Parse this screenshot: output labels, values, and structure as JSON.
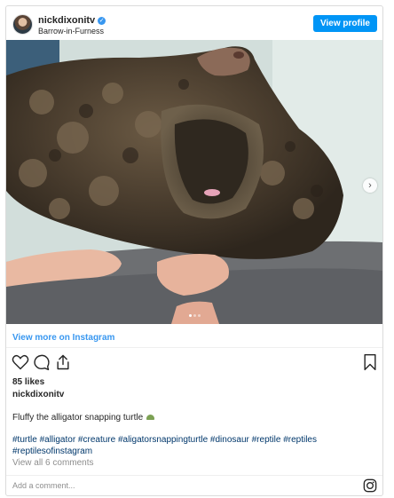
{
  "header": {
    "username": "nickdixonitv",
    "verified_icon": "verified-badge-icon",
    "location": "Barrow-in-Furness",
    "view_profile_label": "View profile"
  },
  "media": {
    "alt": "Fluffy the alligator snapping turtle",
    "carousel_dots": 3,
    "active_dot": 1,
    "next_icon": "chevron-right-icon"
  },
  "links": {
    "view_more": "View more on Instagram"
  },
  "actions": {
    "icons": [
      "heart-icon",
      "comment-icon",
      "share-icon",
      "bookmark-icon"
    ]
  },
  "post": {
    "likes": "85 likes",
    "author": "nickdixonitv",
    "caption": "Fluffy the alligator snapping turtle",
    "caption_emoji": "turtle-emoji",
    "hashtags": "#turtle #alligator #creature #aligatorsnappingturtle #dinosaur #reptile #reptiles #reptilesofinstagram",
    "view_comments": "View all 6 comments"
  },
  "comment": {
    "placeholder": "Add a comment...",
    "icon": "instagram-icon"
  },
  "colors": {
    "accent": "#3897f0",
    "button": "#0095f6",
    "text": "#262626",
    "muted": "#8e8e8e"
  }
}
